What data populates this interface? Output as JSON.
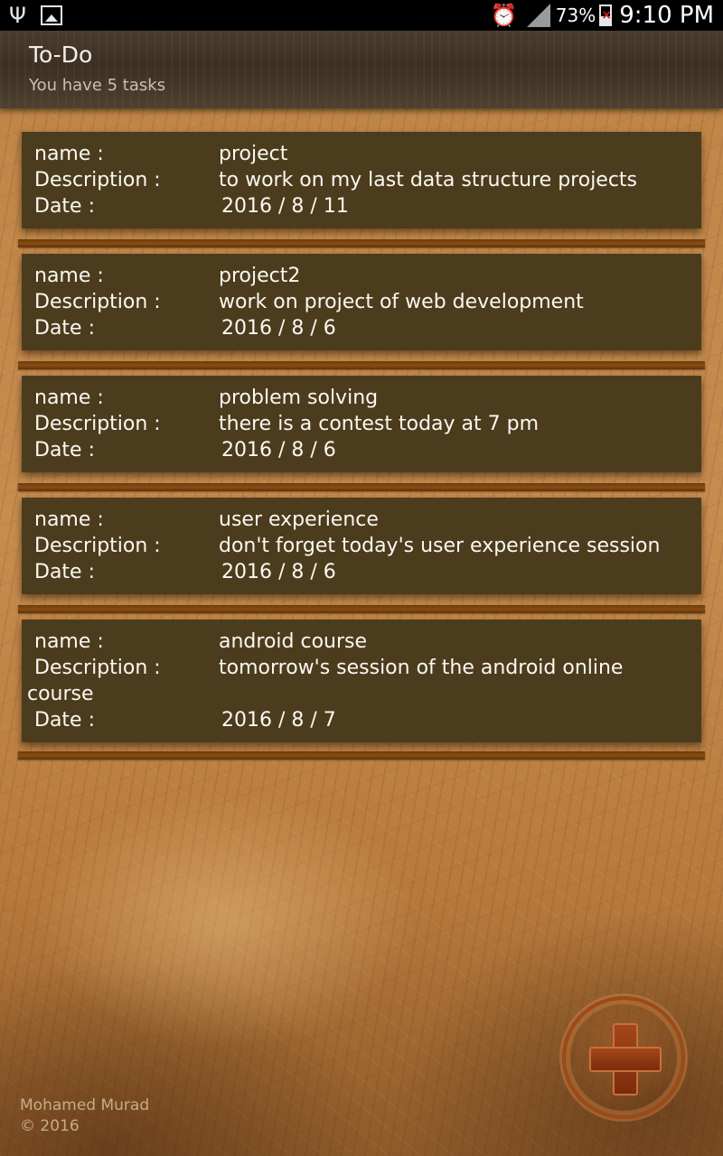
{
  "status_bar": {
    "left_icons": [
      "usb-icon",
      "image-icon"
    ],
    "right_icons": [
      "alarm-icon",
      "signal-icon",
      "battery-icon"
    ],
    "battery_percent": "73%",
    "time": "9:10 PM"
  },
  "action_bar": {
    "title": "To-Do",
    "subtitle": "You have 5 tasks"
  },
  "labels": {
    "name": "name :",
    "description": "Description :",
    "date": "Date :"
  },
  "tasks": [
    {
      "name": "project",
      "description": "to work on my last data structure projects",
      "date": "2016 / 8 / 11"
    },
    {
      "name": "project2",
      "description": "work on project of web development",
      "date": "2016 / 8 / 6"
    },
    {
      "name": "problem solving",
      "description": "there is a contest today at 7 pm",
      "date": "2016 / 8 / 6"
    },
    {
      "name": "user experience",
      "description": "don't forget today's user experience session",
      "date": "2016 / 8 / 6"
    },
    {
      "name": "android course",
      "description": "tomorrow's session of the android online",
      "description_cont": "course",
      "date": "2016 / 8 / 7"
    }
  ],
  "footer": {
    "author": "Mohamed Murad",
    "copyright": "© 2016"
  },
  "fab": {
    "icon": "plus-icon"
  }
}
